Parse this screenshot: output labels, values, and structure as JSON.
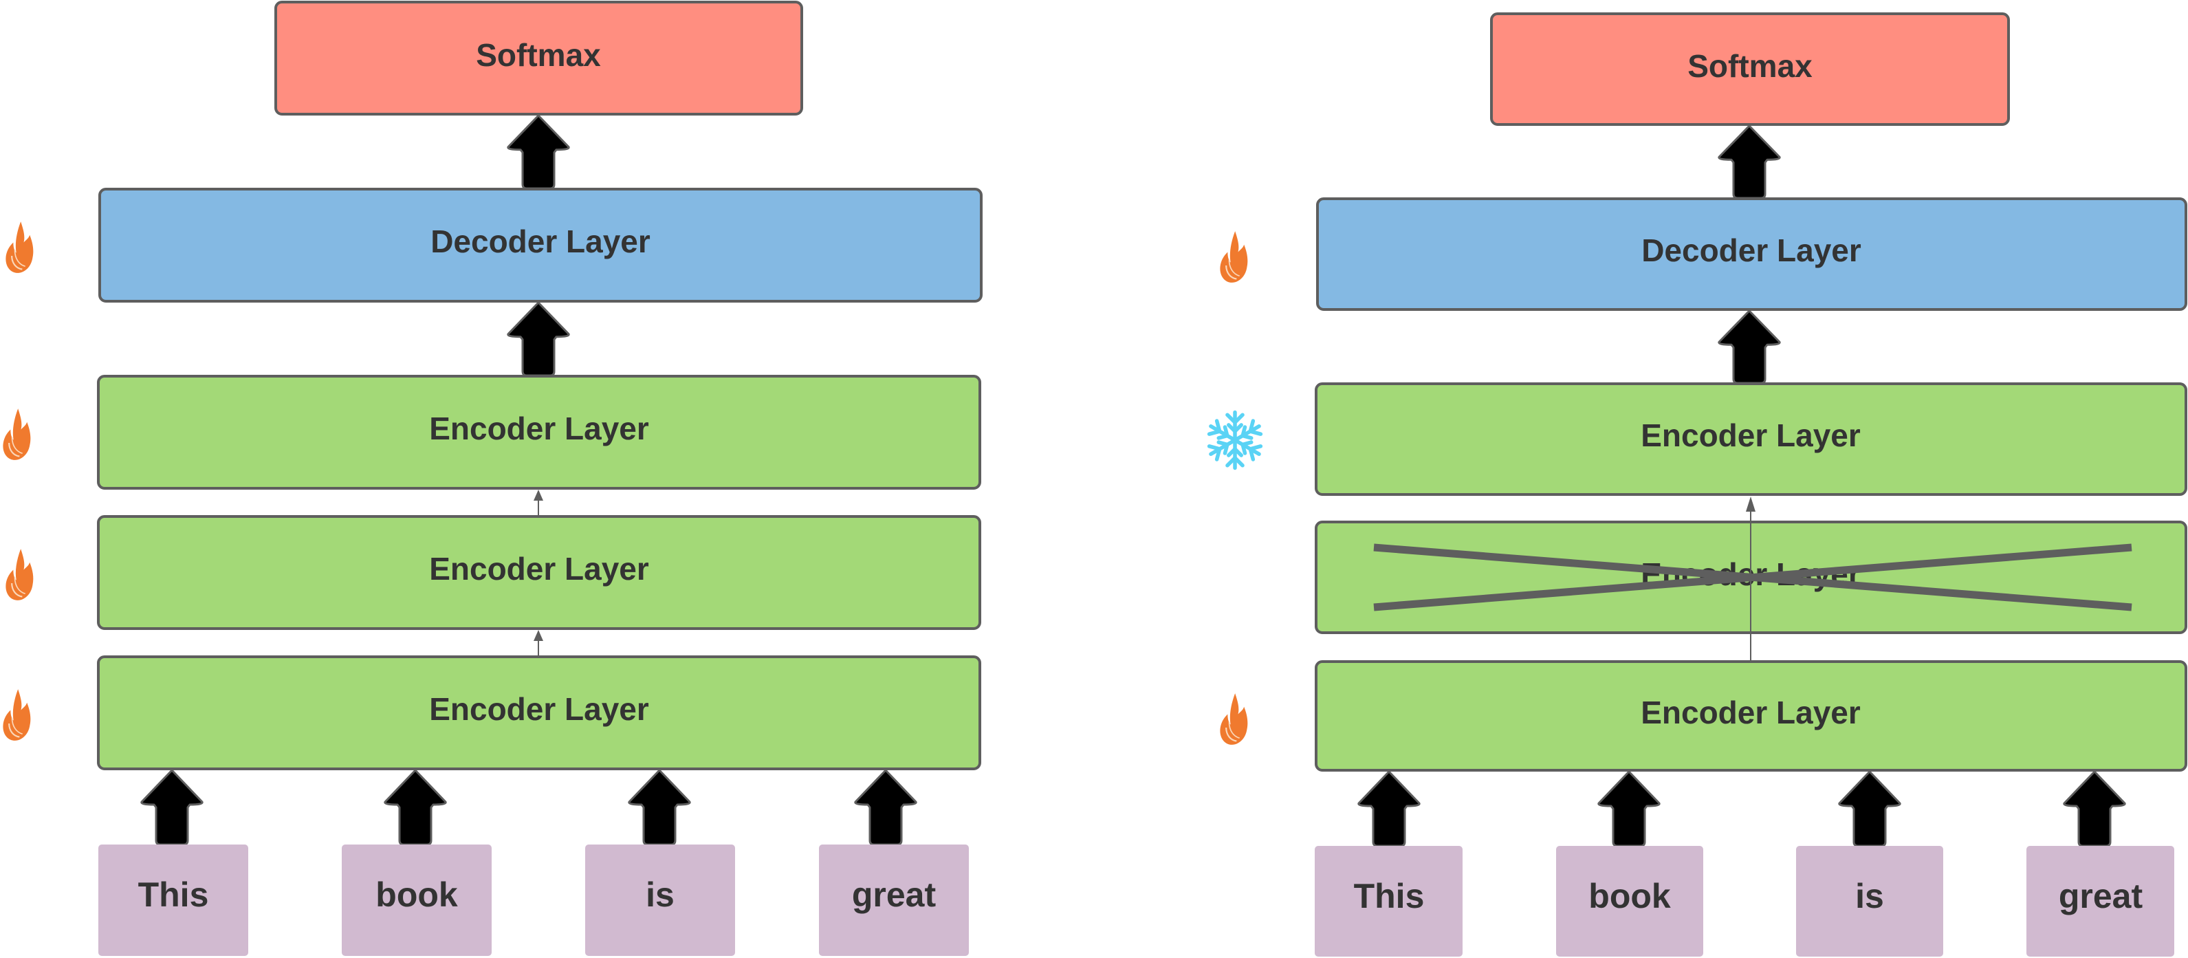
{
  "colors": {
    "softmax": "#ff8e80",
    "decoder": "#84b9e3",
    "encoder": "#a3d977",
    "token": "#d1bad0",
    "border": "#5e5e5e",
    "text": "#333333",
    "arrow_fill": "#000000",
    "flame": "#f07a2e",
    "snowflake": "#5ad3f5",
    "cross": "#5e5e5e"
  },
  "left_panel": {
    "softmax": {
      "label": "Softmax"
    },
    "decoder": {
      "label": "Decoder Layer",
      "status": "trainable",
      "status_icon": "flame-icon"
    },
    "encoders": [
      {
        "label": "Encoder Layer",
        "status": "trainable",
        "status_icon": "flame-icon",
        "removed": false
      },
      {
        "label": "Encoder Layer",
        "status": "trainable",
        "status_icon": "flame-icon",
        "removed": false
      },
      {
        "label": "Encoder Layer",
        "status": "trainable",
        "status_icon": "flame-icon",
        "removed": false
      }
    ],
    "tokens": [
      "This",
      "book",
      "is",
      "great"
    ]
  },
  "right_panel": {
    "softmax": {
      "label": "Softmax"
    },
    "decoder": {
      "label": "Decoder Layer",
      "status": "trainable",
      "status_icon": "flame-icon"
    },
    "encoders": [
      {
        "label": "Encoder Layer",
        "status": "frozen",
        "status_icon": "snowflake-icon",
        "removed": false
      },
      {
        "label": "Encoder Layer",
        "status": "dropped",
        "status_icon": "",
        "removed": true
      },
      {
        "label": "Encoder Layer",
        "status": "trainable",
        "status_icon": "flame-icon",
        "removed": false
      }
    ],
    "tokens": [
      "This",
      "book",
      "is",
      "great"
    ]
  }
}
